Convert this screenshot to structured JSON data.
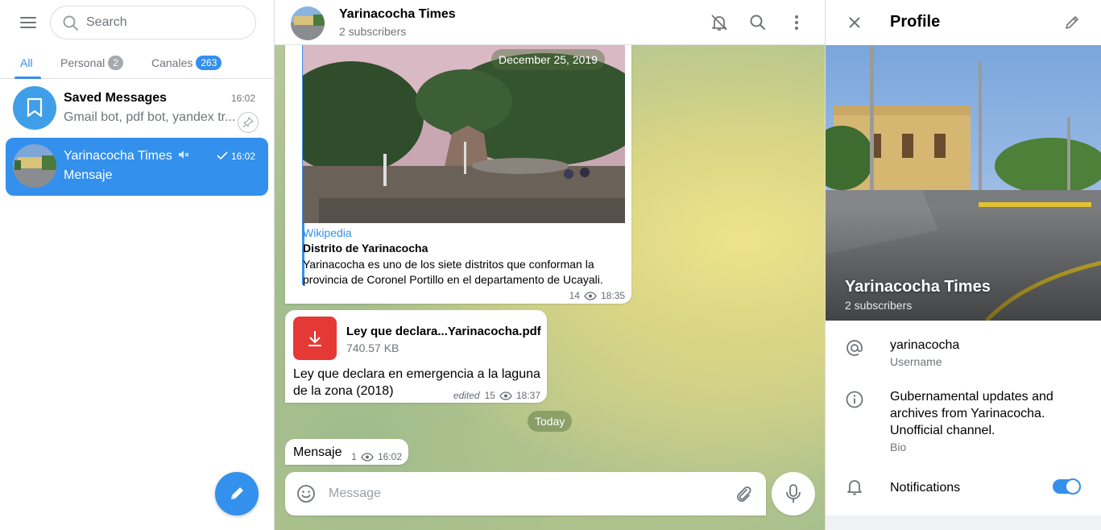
{
  "colors": {
    "accent": "#3390ec",
    "secondary_text": "#707579",
    "file_icon": "#e53935"
  },
  "sidebar": {
    "search_placeholder": "Search",
    "tabs": [
      {
        "label": "All",
        "count": ""
      },
      {
        "label": "Personal",
        "count": "2"
      },
      {
        "label": "Canales",
        "count": "263"
      }
    ],
    "chats": [
      {
        "title": "Saved Messages",
        "time": "16:02",
        "preview": "Gmail bot, pdf bot, yandex tr...",
        "icon": "bookmark-icon"
      },
      {
        "title": "Yarinacocha Times",
        "time": "16:02",
        "preview": "Mensaje",
        "icon": "muted-icon"
      }
    ]
  },
  "chat": {
    "title": "Yarinacocha Times",
    "subtitle": "2 subscribers",
    "messages": {
      "link": {
        "date_overlay": "December 25, 2019",
        "site": "Wikipedia",
        "title": "Distrito de Yarinacocha",
        "description": "Yarinacocha es uno de los siete distritos que conforman la provincia de Coronel Portillo en el departamento de Ucayali.",
        "views": "14",
        "time": "18:35"
      },
      "file": {
        "name": "Ley que declara...Yarinacocha.pdf",
        "size": "740.57 KB",
        "caption": "Ley que declara en emergencia a la laguna de la zona (2018)",
        "edited": "edited",
        "views": "15",
        "time": "18:37"
      },
      "today_label": "Today",
      "text": {
        "body": "Mensaje",
        "views": "1",
        "time": "16:02"
      }
    },
    "composer_placeholder": "Message"
  },
  "profile": {
    "title": "Profile",
    "name": "Yarinacocha Times",
    "subscribers": "2 subscribers",
    "username": "yarinacocha",
    "username_label": "Username",
    "bio": "Gubernamental updates and archives from Yarinacocha. Unofficial channel.",
    "bio_label": "Bio",
    "notifications_label": "Notifications",
    "notifications_on": true
  }
}
